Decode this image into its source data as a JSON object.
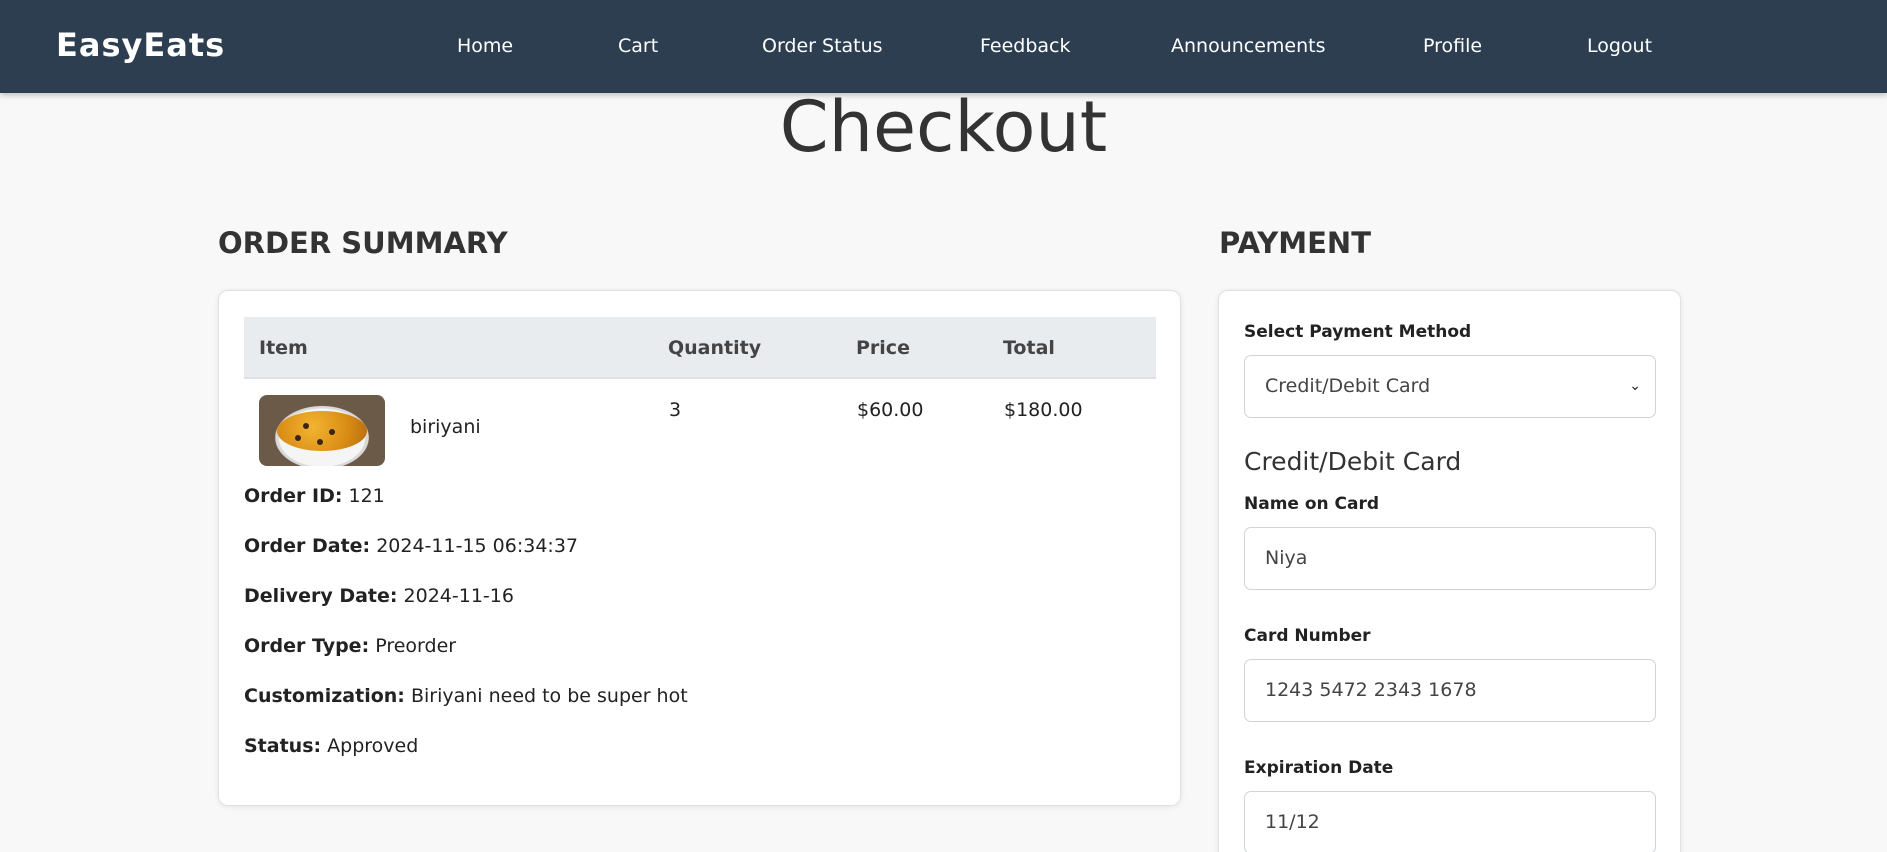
{
  "brand": "EasyEats",
  "nav": [
    "Home",
    "Cart",
    "Order Status",
    "Feedback",
    "Announcements",
    "Profile",
    "Logout"
  ],
  "page_title": "Checkout",
  "order_summary": {
    "heading": "ORDER SUMMARY",
    "columns": [
      "Item",
      "Quantity",
      "Price",
      "Total"
    ],
    "rows": [
      {
        "item": "biriyani",
        "quantity": "3",
        "price": "$60.00",
        "total": "$180.00"
      }
    ],
    "details": [
      {
        "label": "Order ID:",
        "value": "121"
      },
      {
        "label": "Order Date:",
        "value": "2024-11-15 06:34:37"
      },
      {
        "label": "Delivery Date:",
        "value": "2024-11-16"
      },
      {
        "label": "Order Type:",
        "value": "Preorder"
      },
      {
        "label": "Customization:",
        "value": "Biriyani need to be super hot"
      },
      {
        "label": "Status:",
        "value": "Approved"
      }
    ]
  },
  "payment": {
    "heading": "PAYMENT",
    "method_label": "Select Payment Method",
    "method_value": "Credit/Debit Card",
    "method_caret": "⌄",
    "card_heading": "Credit/Debit Card",
    "name_label": "Name on Card",
    "name_value": "Niya",
    "number_label": "Card Number",
    "number_value": "1243 5472 2343 1678",
    "expiry_label": "Expiration Date",
    "expiry_value": "11/12"
  },
  "colors": {
    "navbar": "#2c3e50",
    "page_bg": "#f8f8f8",
    "table_header": "#e9ecef"
  }
}
